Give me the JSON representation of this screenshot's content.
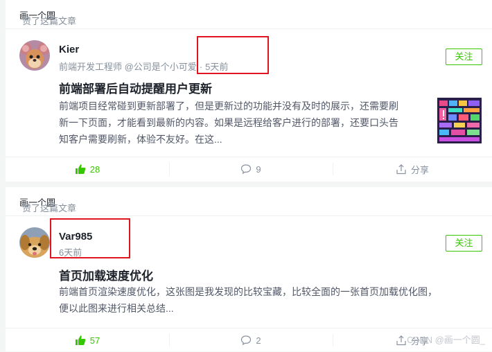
{
  "feed": [
    {
      "liked_by": "画一个圆",
      "liked_action": "赞了这篇文章",
      "author": {
        "name": "Kier",
        "title": "前端开发工程师 @公司是个小可爱",
        "time": "5天前"
      },
      "follow_label": "关注",
      "article": {
        "title": "前端部署后自动提醒用户更新",
        "excerpt_lines": [
          "前端项目经常碰到更新部署了，但是更新过的功能并没有及时的展示，还需要刷",
          "新一下页面，才能看到最新的内容。如果是远程给客户进行的部署，还要口头告",
          "知客户需要刷新，体验不友好。在这..."
        ],
        "has_thumbnail": true
      },
      "stats": {
        "likes": "28",
        "comments": "9",
        "share_label": "分享"
      }
    },
    {
      "liked_by": "画一个圆",
      "liked_action": "赞了这篇文章",
      "author": {
        "name": "Var985",
        "title": "",
        "time": "6天前"
      },
      "follow_label": "关注",
      "article": {
        "title": "首页加载速度优化",
        "excerpt_lines": [
          "前端首页渲染速度优化，这张图是我发现的比较宝藏，比较全面的一张首页加载优化图，",
          "便以此图来进行相关总结..."
        ],
        "has_thumbnail": false
      },
      "stats": {
        "likes": "57",
        "comments": "2",
        "share_label": "分享"
      }
    }
  ],
  "watermark": "CSDN @画一个圆_",
  "colors": {
    "accent_green": "#37c700",
    "highlight_red": "#e0141e",
    "muted": "#86909c"
  },
  "icons": {
    "like": "thumbs-up-icon",
    "comment": "comment-bubble-icon",
    "share": "share-icon"
  }
}
